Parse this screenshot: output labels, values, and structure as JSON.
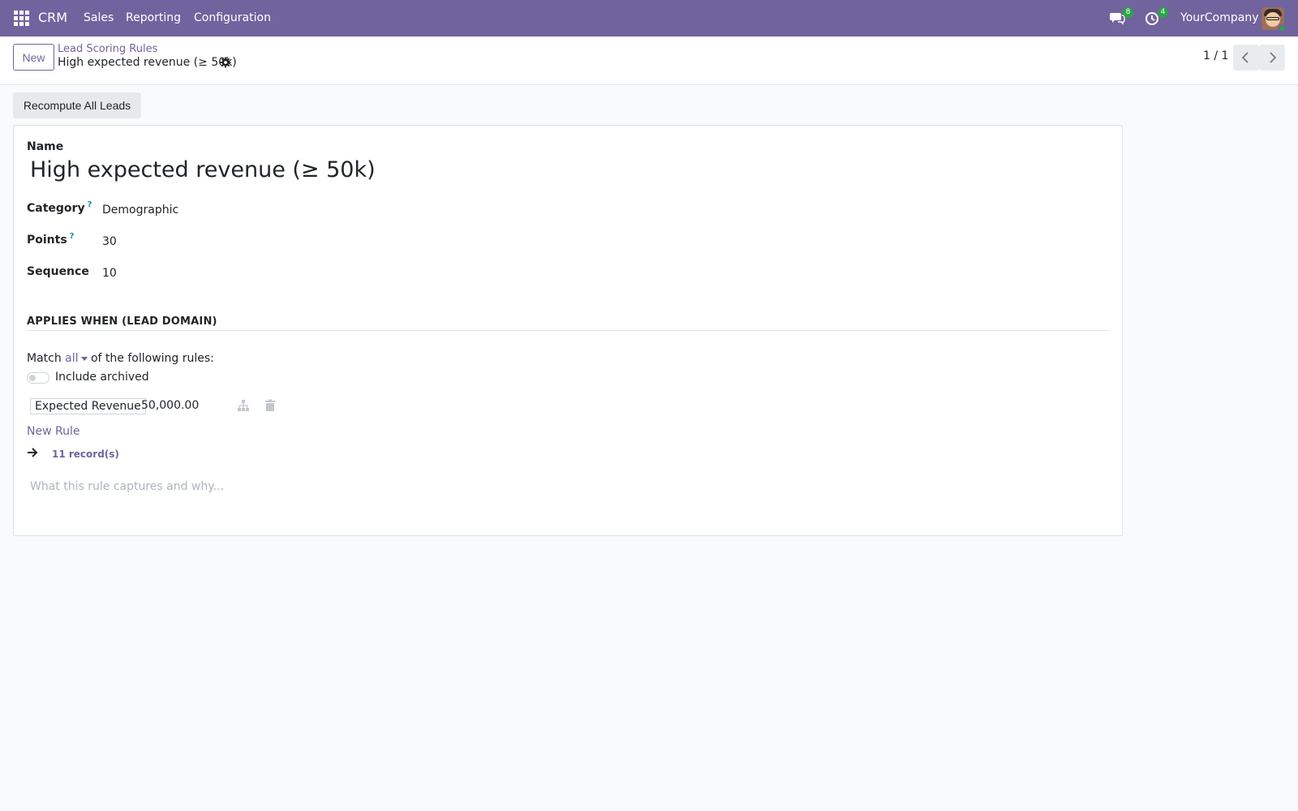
{
  "navbar": {
    "app_name": "CRM",
    "menus": [
      "Sales",
      "Reporting",
      "Configuration"
    ],
    "messages_count": "8",
    "activities_count": "4",
    "company": "YourCompany"
  },
  "control_panel": {
    "new_label": "New",
    "breadcrumb_parent": "Lead Scoring Rules",
    "breadcrumb_current": "High expected revenue (≥ 50k)",
    "pager": "1 / 1"
  },
  "actions": {
    "recompute_label": "Recompute All Leads"
  },
  "form": {
    "name_label": "Name",
    "name_value": "High expected revenue (≥ 50k)",
    "category_label": "Category",
    "category_help": "?",
    "category_value": "Demographic",
    "points_label": "Points",
    "points_help": "?",
    "points_value": "30",
    "sequence_label": "Sequence",
    "sequence_value": "10",
    "section_title": "APPLIES WHEN (LEAD DOMAIN)",
    "match_prefix": "Match",
    "match_value": "all",
    "match_suffix": "of the following rules:",
    "include_archived_label": "Include archived",
    "rule": {
      "field": "Expected Revenue",
      "operator": ".",
      "value": "50,000.00"
    },
    "new_rule_label": "New Rule",
    "records_label": "11 record(s)",
    "notes_placeholder": "What this rule captures and why..."
  },
  "colors": {
    "brand": "#71639e",
    "badge": "#28a745",
    "help": "#0d8fa8"
  }
}
